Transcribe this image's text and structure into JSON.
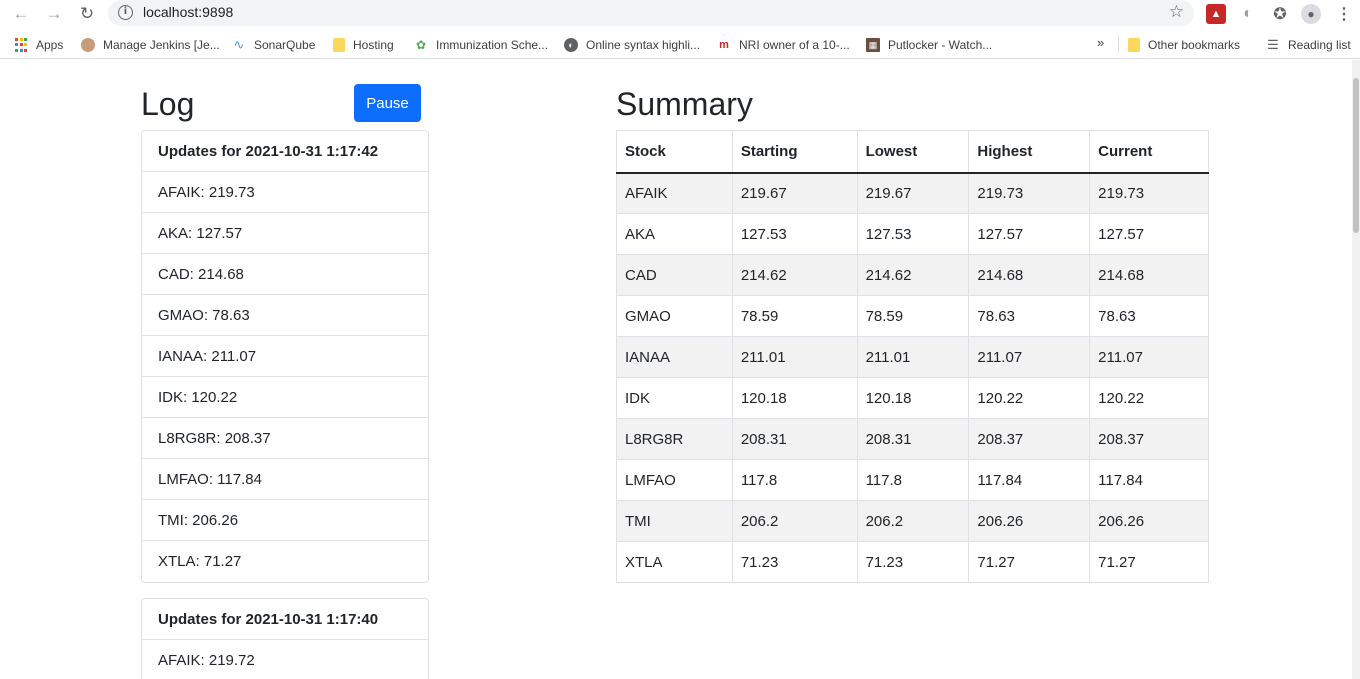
{
  "browser": {
    "url": "localhost:9898",
    "bookmarks": [
      {
        "label": "Apps",
        "icon": "apps-grid-icon"
      },
      {
        "label": "Manage Jenkins [Je...",
        "icon": "jenkins-avatar-icon"
      },
      {
        "label": "SonarQube",
        "icon": "sonarqube-icon"
      },
      {
        "label": "Hosting",
        "icon": "folder-icon"
      },
      {
        "label": "Immunization Sche...",
        "icon": "immunization-icon"
      },
      {
        "label": "Online syntax highli...",
        "icon": "globe-icon"
      },
      {
        "label": "NRI owner of a 10-...",
        "icon": "nri-icon"
      },
      {
        "label": "Putlocker - Watch...",
        "icon": "film-icon"
      }
    ],
    "more_bookmarks": "»",
    "other_bookmarks": "Other bookmarks",
    "reading_list": "Reading list"
  },
  "log": {
    "title": "Log",
    "pause_label": "Pause",
    "updates": [
      {
        "header": "Updates for 2021-10-31 1:17:42",
        "items": [
          "AFAIK: 219.73",
          "AKA: 127.57",
          "CAD: 214.68",
          "GMAO: 78.63",
          "IANAA: 211.07",
          "IDK: 120.22",
          "L8RG8R: 208.37",
          "LMFAO: 117.84",
          "TMI: 206.26",
          "XTLA: 71.27"
        ]
      },
      {
        "header": "Updates for 2021-10-31 1:17:40",
        "items": [
          "AFAIK: 219.72"
        ]
      }
    ]
  },
  "summary": {
    "title": "Summary",
    "columns": [
      "Stock",
      "Starting",
      "Lowest",
      "Highest",
      "Current"
    ],
    "rows": [
      [
        "AFAIK",
        "219.67",
        "219.67",
        "219.73",
        "219.73"
      ],
      [
        "AKA",
        "127.53",
        "127.53",
        "127.57",
        "127.57"
      ],
      [
        "CAD",
        "214.62",
        "214.62",
        "214.68",
        "214.68"
      ],
      [
        "GMAO",
        "78.59",
        "78.59",
        "78.63",
        "78.63"
      ],
      [
        "IANAA",
        "211.01",
        "211.01",
        "211.07",
        "211.07"
      ],
      [
        "IDK",
        "120.18",
        "120.18",
        "120.22",
        "120.22"
      ],
      [
        "L8RG8R",
        "208.31",
        "208.31",
        "208.37",
        "208.37"
      ],
      [
        "LMFAO",
        "117.8",
        "117.8",
        "117.84",
        "117.84"
      ],
      [
        "TMI",
        "206.2",
        "206.2",
        "206.26",
        "206.26"
      ],
      [
        "XTLA",
        "71.23",
        "71.23",
        "71.27",
        "71.27"
      ]
    ]
  },
  "colors": {
    "primary_button": "#0d6efd",
    "table_stripe": "#f2f2f2"
  }
}
